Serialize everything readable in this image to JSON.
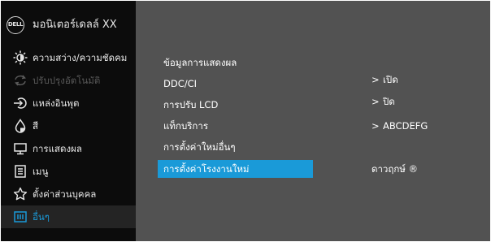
{
  "brand": {
    "logo_text": "DELL",
    "title": "มอนิเตอร์เดลล์ XX"
  },
  "sidebar": {
    "items": [
      {
        "label": "ความสว่าง/ความชัดคม",
        "icon": "brightness-icon"
      },
      {
        "label": "ปรับปรุงอัตโนมัติ",
        "icon": "auto-adjust-icon"
      },
      {
        "label": "แหล่งอินพุต",
        "icon": "input-source-icon"
      },
      {
        "label": "สี",
        "icon": "color-icon"
      },
      {
        "label": "การแสดงผล",
        "icon": "display-icon"
      },
      {
        "label": "เมนู",
        "icon": "menu-icon"
      },
      {
        "label": "ตั้งค่าส่วนบุคคล",
        "icon": "star-icon"
      },
      {
        "label": "อื่นๆ",
        "icon": "others-icon"
      }
    ]
  },
  "main": {
    "rows": [
      {
        "label": "ข้อมูลการแสดงผล"
      },
      {
        "label": "DDC/CI"
      },
      {
        "label": "การปรับ LCD"
      },
      {
        "label": "แท็กบริการ"
      },
      {
        "label": "การตั้งค่าใหม่อื่นๆ"
      },
      {
        "label": "การตั้งค่าโรงงานใหม่"
      }
    ],
    "values": [
      {
        "chevron": ">",
        "text": "เปิด"
      },
      {
        "chevron": ">",
        "text": "ปิด"
      },
      {
        "chevron": ">",
        "text": "ABCDEFG"
      },
      {
        "chevron": "",
        "text": "ดาวฤกษ์ ®"
      }
    ]
  },
  "colors": {
    "accent": "#1a9ad8",
    "panel": "#525252",
    "sidebar": "#0c0c0c",
    "disabled": "#5a5a5a"
  }
}
